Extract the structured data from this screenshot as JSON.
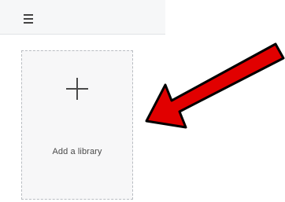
{
  "header": {
    "menu_icon": "hamburger-menu-icon"
  },
  "library": {
    "add_card": {
      "icon": "plus-icon",
      "label": "Add a library"
    }
  },
  "annotation": {
    "arrow_color": "#e10000",
    "arrow_outline": "#000000",
    "icon": "red-arrow-icon"
  }
}
